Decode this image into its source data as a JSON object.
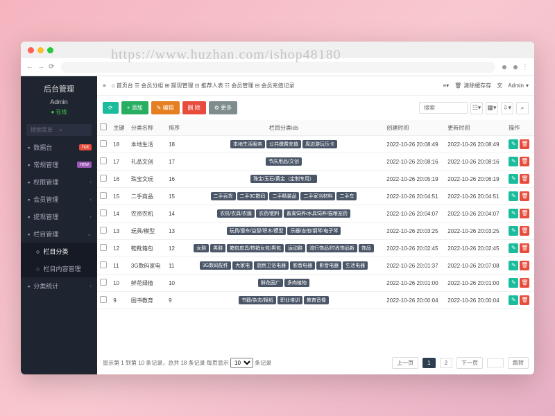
{
  "sidebar": {
    "title": "后台管理",
    "user": "Admin",
    "status": "● 在线",
    "search_placeholder": "搜索菜单",
    "items": [
      {
        "label": "数据台",
        "badge": "hot"
      },
      {
        "label": "常规管理",
        "badge": "new"
      },
      {
        "label": "权限管理",
        "chev": "‹"
      },
      {
        "label": "会员管理",
        "chev": "‹"
      },
      {
        "label": "提现管理",
        "chev": "‹"
      },
      {
        "label": "栏目管理",
        "chev": "⌄",
        "expanded": true
      },
      {
        "label": "栏目分类",
        "sub": true,
        "active": true
      },
      {
        "label": "栏目内容管理",
        "sub": true
      },
      {
        "label": "分类统计",
        "chev": "‹"
      }
    ]
  },
  "topnav": {
    "items": [
      "首页台",
      "会员分组",
      "提现管理",
      "推荐人表",
      "会员管理",
      "会员充值记录"
    ],
    "right": [
      "清除缓存存",
      "Admin"
    ]
  },
  "toolbar": {
    "refresh": "⟳",
    "add": "+ 添加",
    "edit": "✎ 编辑",
    "delete": "删 除",
    "more": "⚙ 更多",
    "search_placeholder": "搜索"
  },
  "table": {
    "headers": [
      "",
      "主键",
      "分类名称",
      "排序",
      "栏目分类ids",
      "创建时间",
      "更新时间",
      "操作"
    ],
    "rows": [
      {
        "id": "18",
        "name": "本地生活",
        "sort": "18",
        "tags": [
          "本地生活服务",
          "公共缴费充值",
          "周边游玩乐卡"
        ],
        "created": "2022-10-26 20:08:49",
        "updated": "2022-10-26 20:08:49"
      },
      {
        "id": "17",
        "name": "礼品文创",
        "sort": "17",
        "tags": [
          "节庆用品/文创"
        ],
        "created": "2022-10-26 20:08:16",
        "updated": "2022-10-26 20:08:16"
      },
      {
        "id": "16",
        "name": "珠宝文玩",
        "sort": "16",
        "tags": [
          "珠宝/玉石/黄金（定制专用）"
        ],
        "created": "2022-10-26 20:05:19",
        "updated": "2022-10-26 20:06:19"
      },
      {
        "id": "15",
        "name": "二手商品",
        "sort": "15",
        "tags": [
          "二手百货",
          "二手3C数码",
          "二手精装品",
          "二手家当材料",
          "二手车"
        ],
        "created": "2022-10-26 20:04:51",
        "updated": "2022-10-26 20:04:51"
      },
      {
        "id": "14",
        "name": "农资农机",
        "sort": "14",
        "tags": [
          "农机/农具/农膜",
          "农药/肥料",
          "畜禽饲养/水具饲养/猫粮宠药"
        ],
        "created": "2022-10-26 20:04:07",
        "updated": "2022-10-26 20:04:07"
      },
      {
        "id": "13",
        "name": "玩具/模型",
        "sort": "13",
        "tags": [
          "玩具/童车/益智/积木/模型",
          "乐器/吉他/钢琴/电子琴"
        ],
        "created": "2022-10-26 20:03:25",
        "updated": "2022-10-26 20:03:25"
      },
      {
        "id": "12",
        "name": "鞋靴箱包",
        "sort": "12",
        "tags": [
          "女鞋",
          "男鞋",
          "箱包皮具/热销女包/男包",
          "运动鞋",
          "流行饰品/时尚饰品新",
          "饰品"
        ],
        "created": "2022-10-26 20:02:45",
        "updated": "2022-10-26 20:02:45"
      },
      {
        "id": "11",
        "name": "3G数码家电",
        "sort": "11",
        "tags": [
          "3G数码配件",
          "大家电",
          "厨房卫浴电器",
          "影音电器",
          "影音电器",
          "生活电器"
        ],
        "created": "2022-10-26 20:01:37",
        "updated": "2022-10-26 20:07:08"
      },
      {
        "id": "10",
        "name": "鲜花绿植",
        "sort": "10",
        "tags": [
          "鲜花园广",
          "多肉植物"
        ],
        "created": "2022-10-26 20:01:00",
        "updated": "2022-10-26 20:01:00"
      },
      {
        "id": "9",
        "name": "图书教育",
        "sort": "9",
        "tags": [
          "书籍/杂志/报纸",
          "职业培训",
          "教育音像"
        ],
        "created": "2022-10-26 20:00:04",
        "updated": "2022-10-26 20:00:04"
      }
    ]
  },
  "pager": {
    "info_prefix": "显示第 1 到第 10 条记录，总共 18 条记录 每页显示",
    "info_suffix": "条记录",
    "page_size": "10",
    "prev": "上一页",
    "next": "下一页",
    "jump": "跳转",
    "pages": [
      "1",
      "2"
    ]
  }
}
